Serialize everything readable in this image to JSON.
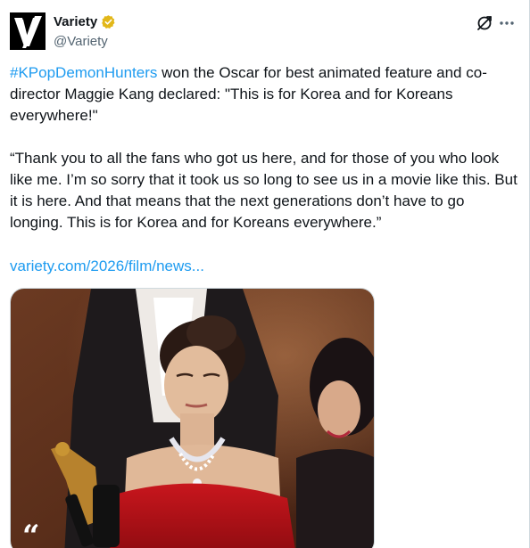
{
  "author": {
    "display_name": "Variety",
    "handle": "@Variety",
    "verified": true,
    "avatar_icon": "variety-v-logo-icon",
    "verified_color": "#e2b719"
  },
  "tweet": {
    "hashtag": "#KPopDemonHunters",
    "paragraph1_rest": " won the Oscar for best animated feature and co-director Maggie Kang declared: \"This is for Korea and for Koreans everywhere!\"",
    "paragraph2": "“Thank you to all the fans who got us here, and for those  of you who look like me. I’m so sorry that it  took us so long to see us in a movie like this. But it is here. And that  means that the next generations don’t have to go longing. This is for Korea and for Koreans everywhere.”",
    "link": "variety.com/2026/film/news..."
  },
  "media": {
    "overlay_glyph": "“"
  },
  "colors": {
    "link": "#1d9bf0",
    "text": "#0f1419",
    "secondary": "#536471"
  },
  "icons": {
    "grok": "grok-icon",
    "more": "more-options-icon"
  }
}
